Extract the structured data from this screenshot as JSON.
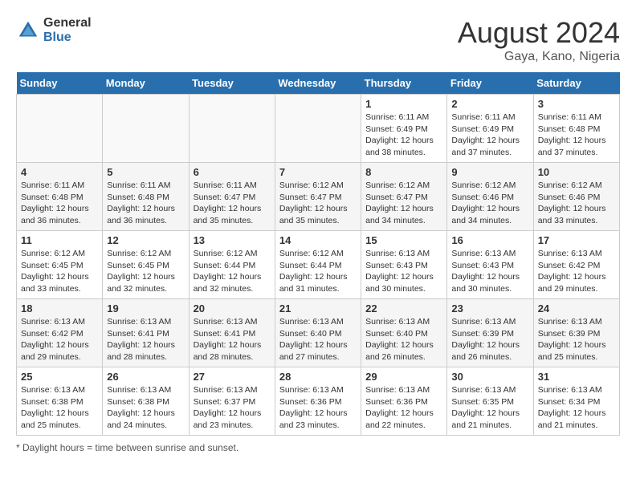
{
  "header": {
    "logo_general": "General",
    "logo_blue": "Blue",
    "month_year": "August 2024",
    "location": "Gaya, Kano, Nigeria"
  },
  "footer": {
    "note": "Daylight hours"
  },
  "days_of_week": [
    "Sunday",
    "Monday",
    "Tuesday",
    "Wednesday",
    "Thursday",
    "Friday",
    "Saturday"
  ],
  "weeks": [
    [
      {
        "day": "",
        "sunrise": "",
        "sunset": "",
        "daylight": ""
      },
      {
        "day": "",
        "sunrise": "",
        "sunset": "",
        "daylight": ""
      },
      {
        "day": "",
        "sunrise": "",
        "sunset": "",
        "daylight": ""
      },
      {
        "day": "",
        "sunrise": "",
        "sunset": "",
        "daylight": ""
      },
      {
        "day": "1",
        "sunrise": "6:11 AM",
        "sunset": "6:49 PM",
        "daylight": "12 hours and 38 minutes."
      },
      {
        "day": "2",
        "sunrise": "6:11 AM",
        "sunset": "6:49 PM",
        "daylight": "12 hours and 37 minutes."
      },
      {
        "day": "3",
        "sunrise": "6:11 AM",
        "sunset": "6:48 PM",
        "daylight": "12 hours and 37 minutes."
      }
    ],
    [
      {
        "day": "4",
        "sunrise": "6:11 AM",
        "sunset": "6:48 PM",
        "daylight": "12 hours and 36 minutes."
      },
      {
        "day": "5",
        "sunrise": "6:11 AM",
        "sunset": "6:48 PM",
        "daylight": "12 hours and 36 minutes."
      },
      {
        "day": "6",
        "sunrise": "6:11 AM",
        "sunset": "6:47 PM",
        "daylight": "12 hours and 35 minutes."
      },
      {
        "day": "7",
        "sunrise": "6:12 AM",
        "sunset": "6:47 PM",
        "daylight": "12 hours and 35 minutes."
      },
      {
        "day": "8",
        "sunrise": "6:12 AM",
        "sunset": "6:47 PM",
        "daylight": "12 hours and 34 minutes."
      },
      {
        "day": "9",
        "sunrise": "6:12 AM",
        "sunset": "6:46 PM",
        "daylight": "12 hours and 34 minutes."
      },
      {
        "day": "10",
        "sunrise": "6:12 AM",
        "sunset": "6:46 PM",
        "daylight": "12 hours and 33 minutes."
      }
    ],
    [
      {
        "day": "11",
        "sunrise": "6:12 AM",
        "sunset": "6:45 PM",
        "daylight": "12 hours and 33 minutes."
      },
      {
        "day": "12",
        "sunrise": "6:12 AM",
        "sunset": "6:45 PM",
        "daylight": "12 hours and 32 minutes."
      },
      {
        "day": "13",
        "sunrise": "6:12 AM",
        "sunset": "6:44 PM",
        "daylight": "12 hours and 32 minutes."
      },
      {
        "day": "14",
        "sunrise": "6:12 AM",
        "sunset": "6:44 PM",
        "daylight": "12 hours and 31 minutes."
      },
      {
        "day": "15",
        "sunrise": "6:13 AM",
        "sunset": "6:43 PM",
        "daylight": "12 hours and 30 minutes."
      },
      {
        "day": "16",
        "sunrise": "6:13 AM",
        "sunset": "6:43 PM",
        "daylight": "12 hours and 30 minutes."
      },
      {
        "day": "17",
        "sunrise": "6:13 AM",
        "sunset": "6:42 PM",
        "daylight": "12 hours and 29 minutes."
      }
    ],
    [
      {
        "day": "18",
        "sunrise": "6:13 AM",
        "sunset": "6:42 PM",
        "daylight": "12 hours and 29 minutes."
      },
      {
        "day": "19",
        "sunrise": "6:13 AM",
        "sunset": "6:41 PM",
        "daylight": "12 hours and 28 minutes."
      },
      {
        "day": "20",
        "sunrise": "6:13 AM",
        "sunset": "6:41 PM",
        "daylight": "12 hours and 28 minutes."
      },
      {
        "day": "21",
        "sunrise": "6:13 AM",
        "sunset": "6:40 PM",
        "daylight": "12 hours and 27 minutes."
      },
      {
        "day": "22",
        "sunrise": "6:13 AM",
        "sunset": "6:40 PM",
        "daylight": "12 hours and 26 minutes."
      },
      {
        "day": "23",
        "sunrise": "6:13 AM",
        "sunset": "6:39 PM",
        "daylight": "12 hours and 26 minutes."
      },
      {
        "day": "24",
        "sunrise": "6:13 AM",
        "sunset": "6:39 PM",
        "daylight": "12 hours and 25 minutes."
      }
    ],
    [
      {
        "day": "25",
        "sunrise": "6:13 AM",
        "sunset": "6:38 PM",
        "daylight": "12 hours and 25 minutes."
      },
      {
        "day": "26",
        "sunrise": "6:13 AM",
        "sunset": "6:38 PM",
        "daylight": "12 hours and 24 minutes."
      },
      {
        "day": "27",
        "sunrise": "6:13 AM",
        "sunset": "6:37 PM",
        "daylight": "12 hours and 23 minutes."
      },
      {
        "day": "28",
        "sunrise": "6:13 AM",
        "sunset": "6:36 PM",
        "daylight": "12 hours and 23 minutes."
      },
      {
        "day": "29",
        "sunrise": "6:13 AM",
        "sunset": "6:36 PM",
        "daylight": "12 hours and 22 minutes."
      },
      {
        "day": "30",
        "sunrise": "6:13 AM",
        "sunset": "6:35 PM",
        "daylight": "12 hours and 21 minutes."
      },
      {
        "day": "31",
        "sunrise": "6:13 AM",
        "sunset": "6:34 PM",
        "daylight": "12 hours and 21 minutes."
      }
    ]
  ]
}
